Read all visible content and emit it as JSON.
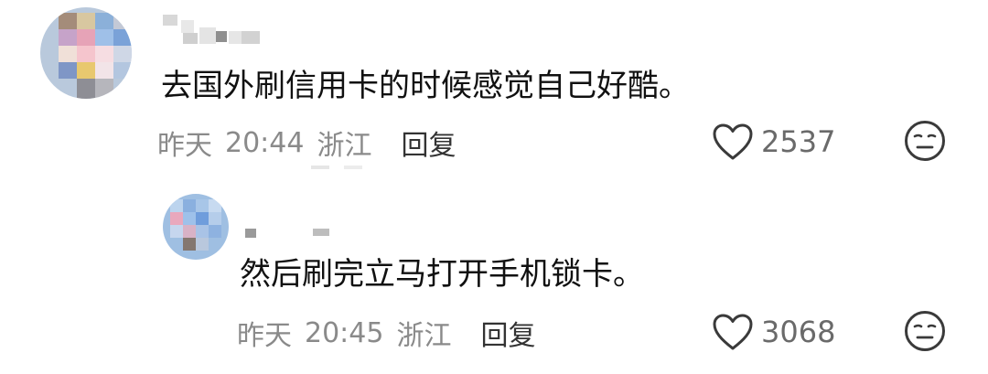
{
  "comments": [
    {
      "text": "去国外刷信用卡的时候感觉自己好酷。",
      "meta": {
        "day": "昨天",
        "time": "20:44",
        "location": "浙江",
        "reply_label": "回复"
      },
      "like_count": "2537"
    },
    {
      "text": "然后刷完立马打开手机锁卡。",
      "meta": {
        "day": "昨天",
        "time": "20:45",
        "location": "浙江",
        "reply_label": "回复"
      },
      "like_count": "3068"
    }
  ],
  "icons": {
    "like": "heart-icon",
    "dislike": "meh-face-icon"
  },
  "colors": {
    "text": "#111111",
    "meta": "#8a8a8a",
    "icon": "#3a3a3a"
  }
}
